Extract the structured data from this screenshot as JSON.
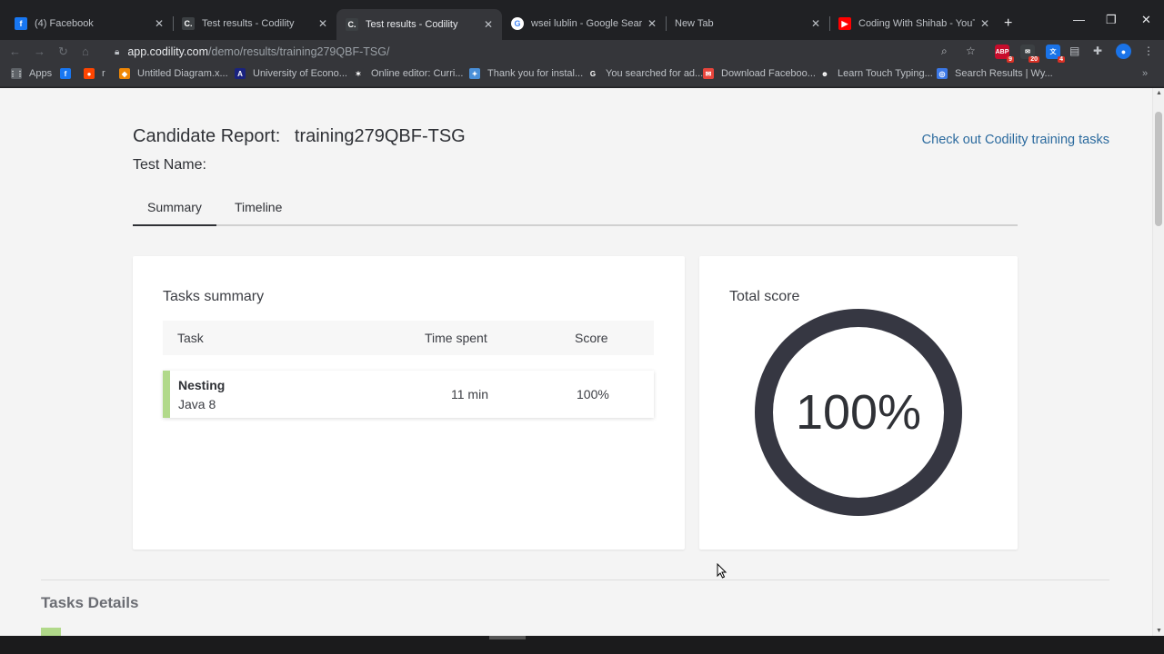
{
  "browser": {
    "tabs": [
      {
        "title": "(4) Facebook",
        "icon": "facebook-icon",
        "color": "#1877f2",
        "glyph": "f"
      },
      {
        "title": "Test results - Codility",
        "icon": "codility-icon",
        "color": "#3c4043",
        "glyph": "C."
      },
      {
        "title": "Test results - Codility",
        "icon": "codility-icon",
        "color": "#3c4043",
        "glyph": "C."
      },
      {
        "title": "wsei lublin - Google Search",
        "icon": "google-icon",
        "color": "#ffffff",
        "glyph": "G"
      },
      {
        "title": "New Tab",
        "icon": "",
        "color": "",
        "glyph": ""
      },
      {
        "title": "Coding With Shihab - YouTube",
        "icon": "youtube-icon",
        "color": "#ff0000",
        "glyph": "▶"
      }
    ],
    "active_tab": 2,
    "url_host": "app.codility.com",
    "url_path": "/demo/results/training279QBF-TSG/",
    "extensions": [
      {
        "name": "abp",
        "badge": "9",
        "color": "#c70d2c",
        "glyph": "ABP"
      },
      {
        "name": "ext-mail",
        "badge": "20",
        "color": "#3c4043",
        "glyph": "✉"
      },
      {
        "name": "ext-translate",
        "badge": "4",
        "color": "#1a73e8",
        "glyph": "文"
      }
    ],
    "bookmarks": [
      {
        "label": "Apps",
        "icon": "apps-grid-icon",
        "color": "#5f6368",
        "glyph": "⋮⋮"
      },
      {
        "label": "",
        "icon": "facebook-icon",
        "color": "#1877f2",
        "glyph": "f"
      },
      {
        "label": "r",
        "icon": "reddit-icon",
        "color": "#ff4500",
        "glyph": "●"
      },
      {
        "label": "Untitled Diagram.x...",
        "icon": "drawio-icon",
        "color": "#f08705",
        "glyph": "◆"
      },
      {
        "label": "University of Econo...",
        "icon": "university-icon",
        "color": "#1a237e",
        "glyph": "A"
      },
      {
        "label": "Online editor: Curri...",
        "icon": "editor-icon",
        "color": "#35363a",
        "glyph": "✶"
      },
      {
        "label": "Thank you for instal...",
        "icon": "install-icon",
        "color": "#4a90d9",
        "glyph": "✦"
      },
      {
        "label": "You searched for ad...",
        "icon": "g-icon",
        "color": "#35363a",
        "glyph": "G"
      },
      {
        "label": "Download Faceboo...",
        "icon": "download-icon",
        "color": "#e8453c",
        "glyph": "✉"
      },
      {
        "label": "Learn Touch Typing...",
        "icon": "typing-icon",
        "color": "#35363a",
        "glyph": "☻"
      },
      {
        "label": "Search Results | Wy...",
        "icon": "search-results-icon",
        "color": "#3b78e7",
        "glyph": "◎"
      }
    ]
  },
  "report": {
    "title_label": "Candidate Report:",
    "candidate_id": "training279QBF-TSG",
    "test_name_label": "Test Name:",
    "training_link": "Check out Codility training tasks",
    "tabs": [
      "Summary",
      "Timeline"
    ],
    "active_tab": 0
  },
  "tasks_summary": {
    "title": "Tasks summary",
    "columns": [
      "Task",
      "Time spent",
      "Score"
    ],
    "rows": [
      {
        "name": "Nesting",
        "language": "Java 8",
        "time_spent": "11 min",
        "score": "100%",
        "status_color": "#b1d98a"
      }
    ]
  },
  "total_score": {
    "title": "Total score",
    "value": "100%",
    "fraction": 1.0,
    "ring_color": "#363742"
  },
  "tasks_details": {
    "title": "Tasks Details"
  }
}
